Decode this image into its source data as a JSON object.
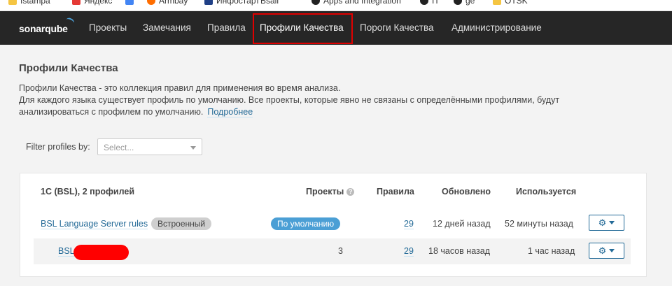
{
  "bookmarks": [
    {
      "label": "Istampa",
      "color": "#f5c542"
    },
    {
      "label": "Яндекс",
      "color": "#e53935"
    },
    {
      "label": "",
      "color": "#4285f4"
    },
    {
      "label": "Armbay",
      "color": "#ff6d00"
    },
    {
      "label": "Инфостарт",
      "color": "#1f3f86"
    },
    {
      "label": "Bsall",
      "color": "#888888"
    },
    {
      "label": "Apps and Integration",
      "color": "#222222"
    },
    {
      "label": "IT",
      "color": "#222222"
    },
    {
      "label": "ge",
      "color": "#222222"
    },
    {
      "label": "OTSK",
      "color": "#f5c542"
    }
  ],
  "nav": {
    "logo": "sonarqube",
    "items": [
      "Проекты",
      "Замечания",
      "Правила",
      "Профили Качества",
      "Пороги Качества",
      "Администрирование"
    ],
    "active_index": 3
  },
  "page": {
    "title": "Профили Качества",
    "desc_line1": "Профили Качества - это коллекция правил для применения во время анализа.",
    "desc_line2": "Для каждого языка существует профиль по умолчанию. Все проекты, которые явно не связаны с определёнными профилями, будут",
    "desc_line3": "анализироваться с профилем по умолчанию.",
    "more_link": "Подробнее"
  },
  "filter": {
    "label": "Filter profiles by:",
    "placeholder": "Select..."
  },
  "table": {
    "group_title": "1С (BSL), 2 профилей",
    "headers": {
      "projects": "Проекты",
      "rules": "Правила",
      "updated": "Обновлено",
      "used": "Используется"
    },
    "rows": [
      {
        "name": "BSL Language Server rules",
        "builtin_badge": "Встроенный",
        "default_badge": "По умолчанию",
        "projects": "",
        "rules": "29",
        "updated": "12 дней назад",
        "used": "52 минуты назад"
      },
      {
        "name": "BSL",
        "builtin_badge": "",
        "default_badge": "",
        "projects": "3",
        "rules": "29",
        "updated": "18 часов назад",
        "used": "1 час назад"
      }
    ]
  },
  "colors": {
    "nav_bg": "#262626",
    "link": "#236a97",
    "default_badge": "#4b9fd5",
    "highlight": "#e00000",
    "redaction": "#ff0000"
  }
}
